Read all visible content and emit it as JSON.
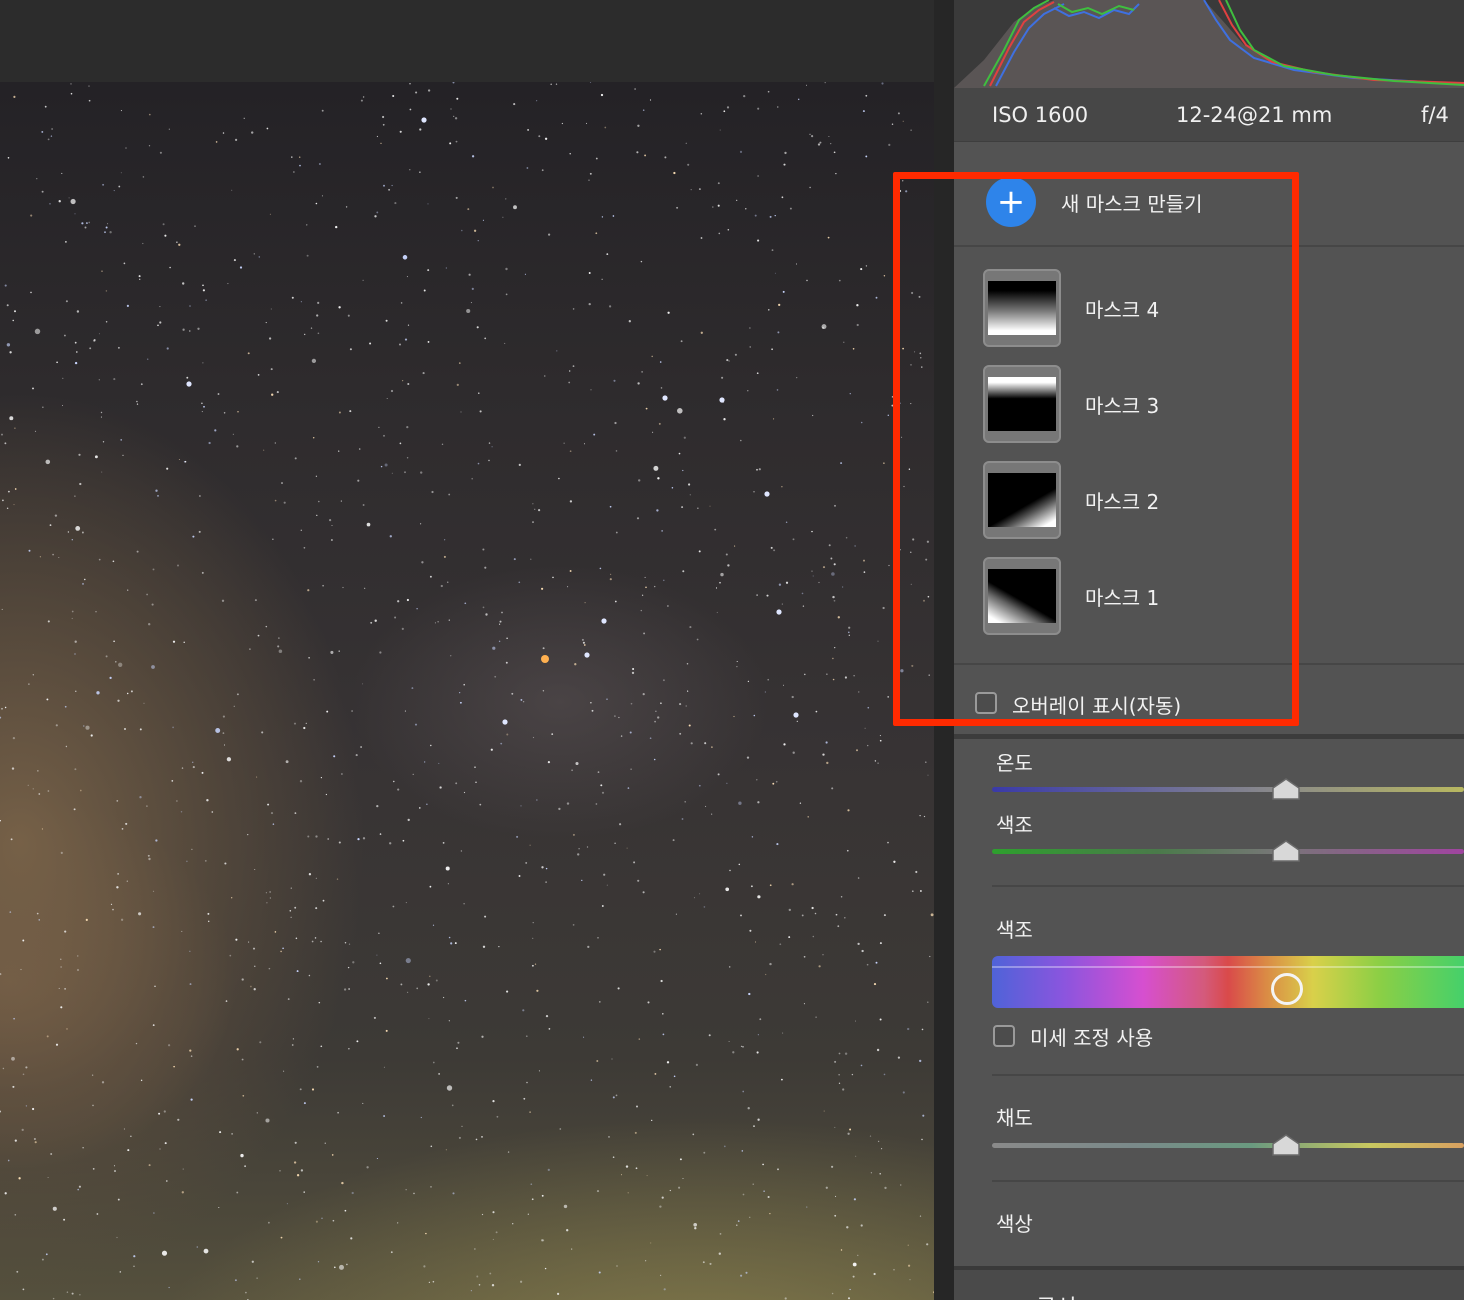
{
  "exif": {
    "iso": "ISO 1600",
    "lens": "12-24@21 mm",
    "aperture": "f/4"
  },
  "masks": {
    "new_mask_label": "새 마스크 만들기",
    "items": [
      {
        "label": "마스크 4",
        "gradient": "top-dark-bottom-light"
      },
      {
        "label": "마스크 3",
        "gradient": "top-light-bottom-dark"
      },
      {
        "label": "마스크 2",
        "gradient": "corner-bottom-right"
      },
      {
        "label": "마스크 1",
        "gradient": "corner-bottom-left"
      }
    ],
    "overlay_label": "오버레이 표시(자동)",
    "overlay_checked": false
  },
  "adjustments": {
    "temperature": {
      "label": "온도",
      "value_fraction": 0.5
    },
    "tint": {
      "label": "색조",
      "value_fraction": 0.5
    },
    "hue": {
      "label": "색조",
      "value_fraction": 0.5,
      "fine_tune_label": "미세 조정 사용",
      "fine_tune_checked": false
    },
    "saturation": {
      "label": "채도",
      "value_fraction": 0.5
    },
    "color": {
      "label": "색상"
    }
  },
  "next_section": {
    "label": "곡선"
  },
  "colors": {
    "highlight": "#ff2a00",
    "accent": "#2e84ea",
    "panel": "#535353"
  },
  "icons": {
    "new_mask": "plus-icon",
    "slider_handle": "triangle-handle-icon",
    "hue_handle": "ring-handle-icon"
  }
}
